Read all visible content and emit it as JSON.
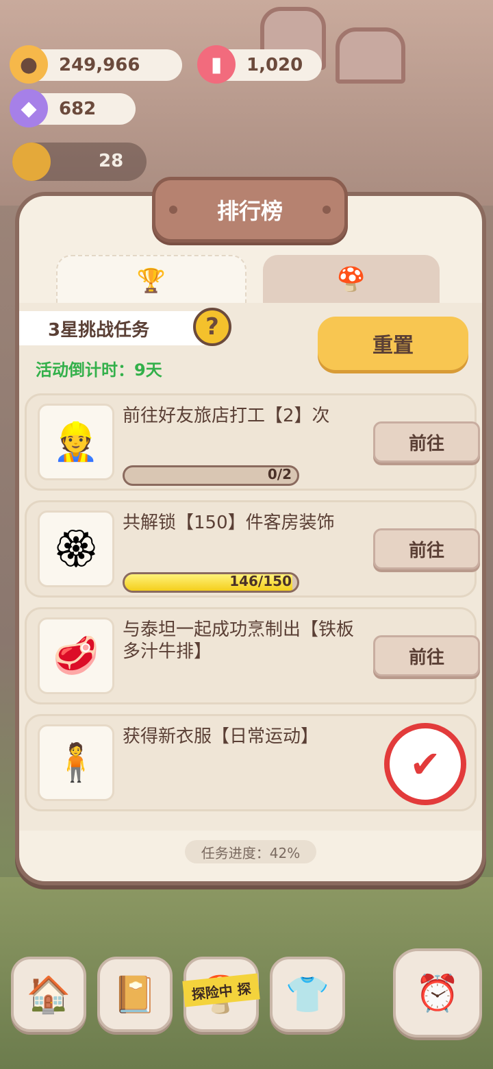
{
  "currency": {
    "coins": "249,966",
    "candles": "1,020",
    "gems": "682",
    "level_count": "28"
  },
  "panel": {
    "title": "排行榜",
    "tabs": [
      {
        "icon": "trophy-icon",
        "active": true
      },
      {
        "icon": "mushroom-icon",
        "active": false
      }
    ],
    "challenge_title": "3星挑战任务",
    "help_symbol": "?",
    "countdown": "活动倒计时：9天",
    "reset_label": "重置",
    "tasks": [
      {
        "text": "前往好友旅店打工【2】次",
        "progress_text": "0/2",
        "progress": 0.0,
        "button": "前往",
        "icon": "worker-girl-icon"
      },
      {
        "text": "共解锁【150】件客房装饰",
        "progress_text": "146/150",
        "progress": 0.973,
        "button": "前往",
        "icon": "decoration-badge-icon"
      },
      {
        "text": "与泰坦一起成功烹制出【铁板多汁牛排】",
        "progress_text": "",
        "progress": null,
        "button": "前往",
        "icon": "steak-plate-icon"
      },
      {
        "text": "获得新衣服【日常运动】",
        "completed": true,
        "icon": "sport-outfit-icon"
      }
    ],
    "task_progress": "任务进度：42%"
  },
  "bottom_nav": [
    {
      "icon": "mushroom-house-icon"
    },
    {
      "icon": "diary-icon"
    },
    {
      "icon": "adventure-icon",
      "tape_label": "探险中 探"
    },
    {
      "icon": "clothes-icon"
    },
    {
      "icon": "character-alarm-icon"
    }
  ]
}
